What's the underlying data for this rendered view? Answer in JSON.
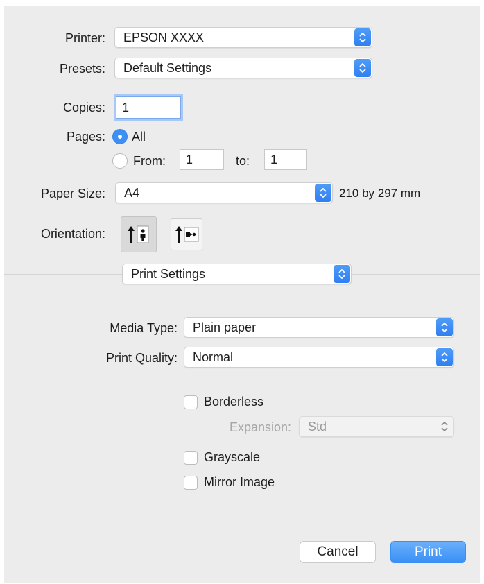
{
  "printer": {
    "label": "Printer:",
    "value": "EPSON XXXX"
  },
  "presets": {
    "label": "Presets:",
    "value": "Default Settings"
  },
  "copies": {
    "label": "Copies:",
    "value": "1"
  },
  "pages": {
    "label": "Pages:",
    "all_label": "All",
    "from_label": "From:",
    "from_value": "1",
    "to_label": "to:",
    "to_value": "1",
    "selected": "All"
  },
  "paper_size": {
    "label": "Paper Size:",
    "value": "A4",
    "dimensions": "210 by 297 mm"
  },
  "orientation": {
    "label": "Orientation:",
    "selected": "portrait"
  },
  "section": {
    "value": "Print Settings"
  },
  "media_type": {
    "label": "Media Type:",
    "value": "Plain paper"
  },
  "print_quality": {
    "label": "Print Quality:",
    "value": "Normal"
  },
  "borderless": {
    "label": "Borderless",
    "checked": false
  },
  "expansion": {
    "label": "Expansion:",
    "value": "Std",
    "enabled": false
  },
  "grayscale": {
    "label": "Grayscale",
    "checked": false
  },
  "mirror_image": {
    "label": "Mirror Image",
    "checked": false
  },
  "buttons": {
    "cancel": "Cancel",
    "print": "Print"
  },
  "colors": {
    "accent": "#3d8ef5",
    "background": "#ececec"
  }
}
